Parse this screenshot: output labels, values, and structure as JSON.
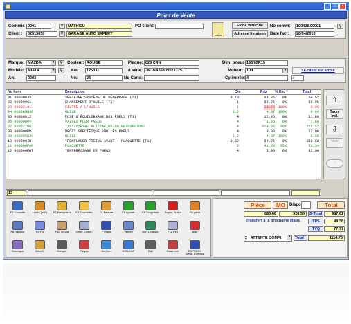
{
  "window": {
    "title": "Point de Vente",
    "min_icon": "minimize-icon",
    "max_icon": "maximize-icon",
    "close_icon": "close-icon"
  },
  "client": {
    "commis_label": "Commis :",
    "commis_value": "0001",
    "commis_name": "MATHIEU",
    "client_label": "Client :",
    "client_value": "02515050",
    "client_name": "GARAGE AUTO EXPERT",
    "po_label": "PO client:",
    "po_value": "",
    "fiche_btn": "Fiche véhicule",
    "adresse_btn": "Adresse livraison",
    "lock_label": "notes",
    "no_comm_label": "No comm:",
    "no_comm_value": "100428.00001",
    "date_fact_label": "Date fact:",
    "date_fact_value": "28/04/2010"
  },
  "vehicle": {
    "marque_label": "Marque:",
    "marque_value": "MAZDA",
    "couleur_label": "Couleur:",
    "couleur_value": "ROUGE",
    "plaque_label": "Plaque:",
    "plaque_value": "828 CRN",
    "dim_label": "Dim. pneus:",
    "dim_value": "195/65R15",
    "modele_label": "Modèle:",
    "modele_value": "MIATA",
    "km_label": "Km:",
    "km_value": "125331",
    "serie_label": "# série:",
    "serie_value": "JM1NA3530V0727251",
    "moteur_label": "Moteur:",
    "moteur_value": "1.8L",
    "arrive_btn": "Le client est arrivé",
    "an_label": "An:",
    "an_value": "2003",
    "no_label": "No:",
    "no_value": "23",
    "nocarte_label": "No Carte:",
    "nocarte_value": "",
    "cyl_label": "Cylindrée:",
    "cyl_value": "4",
    "cyl_extra": ":"
  },
  "grid": {
    "headers": {
      "no": "No Item",
      "desc": "Description",
      "qte": "Qte",
      "prix": "Prix",
      "esc": "% Esc",
      "total": "Total"
    },
    "rows": [
      {
        "no": "01  000000JV",
        "desc": "VÉRIFIER SYSTÈME DE DÉMARRAGE (T1)",
        "qte": "0.78",
        "prix": "69.95",
        "esc": "0%",
        "total": "54.52",
        "color": "#000000"
      },
      {
        "no": "02  000000C1",
        "desc": "CHANGEMENT D'HUILE (T1)",
        "qte": "1",
        "prix": "69.95",
        "esc": "0%",
        "total": "69.95",
        "color": "#000000"
      },
      {
        "no": "03  00002141",
        "desc": "FILTRE  A L'HUILE",
        "qte": "1",
        "prix": "13.29",
        "esc": "100%",
        "total": "0.00",
        "color": "#cc2222"
      },
      {
        "no": "04  000005W30",
        "desc": "HUILE",
        "qte": "3.2",
        "prix": "4.07",
        "esc": "100%",
        "total": "0.00",
        "color": "#1a8a1a"
      },
      {
        "no": "05  00000012",
        "desc": "POSE & ÉQUILIBRAGE DES PNEUS (T1)",
        "qte": "4",
        "prix": "12.95",
        "esc": "0%",
        "total": "51.80",
        "color": "#000000"
      },
      {
        "no": "06  0000000V",
        "desc": "VALVES POUR PNEUS",
        "qte": "4",
        "prix": "1.95",
        "esc": "0%",
        "total": "7.80",
        "color": "#1a8a1a"
      },
      {
        "no": "07  BS062790",
        "desc": "*195/65R14E BLIZZAK WS-80 BRIDGESTONE",
        "qte": "4",
        "prix": "224.00",
        "esc": "38%",
        "total": "555.52",
        "color": "#1a8a1a"
      },
      {
        "no": "08  000000DR",
        "desc": "DROIT SPECIFIQUE SUR LES PNEUS",
        "qte": "4",
        "prix": "3.00",
        "esc": "0%",
        "total": "12.00",
        "color": "#000000"
      },
      {
        "no": "09  000005W30",
        "desc": "HUILE",
        "qte": "3.2",
        "prix": "4.07",
        "esc": "100%",
        "total": "0.00",
        "color": "#1a8a1a"
      },
      {
        "no": "10  000000JR",
        "desc": "*REMPLACER FREINS AVANT - PLAQUETTE (T1)",
        "qte": "2.32",
        "prix": "64.95",
        "esc": "0%",
        "total": "150.68",
        "color": "#000000"
      },
      {
        "no": "11  000000PAD",
        "desc": "PLAQUETTE",
        "qte": "2",
        "prix": "41.03",
        "esc": "35%",
        "total": "53.34",
        "color": "#1a8a1a"
      },
      {
        "no": "12  000000ENT",
        "desc": "*ENTREPOSAGE DE PNEUS",
        "qte": "4",
        "prix": "8.00",
        "esc": "0%",
        "total": "32.00",
        "color": "#000000"
      }
    ],
    "input_no": "13"
  },
  "side": {
    "up": "⇧",
    "taxes": "Taxes Incl.",
    "down": "⇩",
    "note": "Note"
  },
  "tools": [
    {
      "label": "F1 Consulte",
      "color": "#3a6cc8"
    },
    {
      "label": "Livrés (x00)",
      "color": "#d98a20"
    },
    {
      "label": "F2 Enregistrer",
      "color": "#e0b030"
    },
    {
      "label": "F3 Soumettre",
      "color": "#f0c040"
    },
    {
      "label": "F4 Facture",
      "color": "#e0a030"
    },
    {
      "label": "F5 Ajouter",
      "color": "#2aa02a"
    },
    {
      "label": "F6 Supprimer",
      "color": "#2aa02a"
    },
    {
      "label": "Suppr. Entier",
      "color": "#d02020"
    },
    {
      "label": "F8 gérer",
      "color": "#e08020"
    },
    {
      "label": "F8 Rapport",
      "color": "#5a7ac8"
    },
    {
      "label": "F9 Fin",
      "color": "#7a8ae0"
    },
    {
      "label": "F10 Travail",
      "color": "#c8a070"
    },
    {
      "label": "Vente Comm.",
      "color": "#a8b0d0"
    },
    {
      "label": "F Maps",
      "color": "#3050b0"
    },
    {
      "label": "Ventes",
      "color": "#6a8ad0"
    },
    {
      "label": "Bon Livraison",
      "color": "#2a8a5a"
    },
    {
      "label": "F11 PDI",
      "color": "#b0b0d0"
    },
    {
      "label": "Aide",
      "color": "#d03030"
    },
    {
      "label": "Historique",
      "color": "#8a6ac0"
    },
    {
      "label": "Bénéfi.",
      "color": "#d0a040"
    },
    {
      "label": "Compte",
      "color": "#5a5a5a"
    },
    {
      "label": "Pièges",
      "color": "#d04040"
    },
    {
      "label": "Co-Gen",
      "color": "#3a8ad0"
    },
    {
      "label": "GEB-CAP",
      "color": "#3a7ad0"
    },
    {
      "label": "Bâti",
      "color": "#606060"
    },
    {
      "label": "Good mer",
      "color": "#c04040"
    },
    {
      "label": "EXPRESS Dédo. Express",
      "color": "#3050b0"
    }
  ],
  "totals": {
    "piece_label": "Pièce",
    "mo_label": "MO",
    "dispo_label": "Dispo",
    "dispo_value": "",
    "total_label": "Total",
    "piece_value": "660.66",
    "mo_value": "326.55",
    "stotal_label": "S-Total",
    "stotal_value": "987.61",
    "transfer_label": "Transfert à la prochaine étape.",
    "tps_label": "TPS",
    "tps_value": "49.38",
    "tvq_label": "TVQ",
    "tvq_value": "77.77",
    "etape": "2 - ATTENTE COMPI",
    "total_value": "1114.76",
    "accent": "#d06a20"
  }
}
